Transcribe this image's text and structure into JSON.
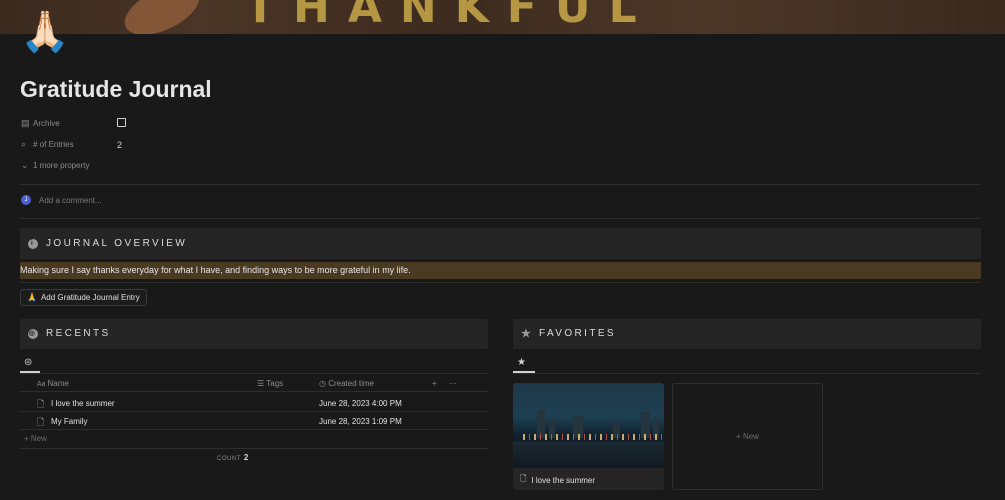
{
  "page": {
    "icon": "🙏🏻",
    "title": "Gratitude Journal"
  },
  "properties": [
    {
      "icon": "archive-icon",
      "label": "Archive",
      "value_type": "checkbox",
      "checked": false
    },
    {
      "icon": "search-icon",
      "label": "# of Entries",
      "value": "2"
    }
  ],
  "more_properties_label": "1 more property",
  "comment": {
    "avatar_letter": "J",
    "placeholder": "Add a comment..."
  },
  "journal_overview": {
    "heading": "JOURNAL OVERVIEW",
    "icon": "info-icon",
    "text": "Making sure I say thanks everyday for what I have, and finding ways to be more grateful in my life."
  },
  "add_entry_button": {
    "icon": "🙏",
    "label": "Add Gratitude Journal Entry"
  },
  "recents": {
    "heading": "RECENTS",
    "icon": "globe-icon",
    "columns": {
      "name": "Name",
      "tags": "Tags",
      "created": "Created time"
    },
    "rows": [
      {
        "name": "I love the summer",
        "created": "June 28, 2023 4:00 PM"
      },
      {
        "name": "My Family",
        "created": "June 28, 2023 1:09 PM"
      }
    ],
    "new_label": "New",
    "count_label": "COUNT",
    "count_value": "2"
  },
  "favorites": {
    "heading": "FAVORITES",
    "icon": "star-icon",
    "cards": [
      {
        "title": "I love the summer"
      }
    ],
    "new_label": "New"
  },
  "colors": {
    "background": "#191919",
    "callout": "#252525",
    "highlight": "#4a3a22",
    "avatar": "#4e5ed3"
  }
}
